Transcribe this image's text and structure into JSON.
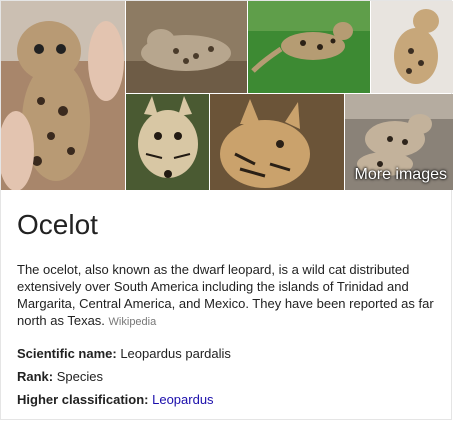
{
  "images": {
    "more_label": "More images",
    "items": [
      {
        "name": "kitten-held",
        "bg": "#a8866b",
        "spot": "#3a2a1e",
        "accent": "#c9b9a8"
      },
      {
        "name": "lying-on-log",
        "bg": "#8d7b63",
        "spot": "#4a3b2a",
        "accent": "#b7a68e"
      },
      {
        "name": "walking-grass",
        "bg": "#3d8a33",
        "spot": "#2b2116",
        "accent": "#b59c73"
      },
      {
        "name": "sitting-white",
        "bg": "#e8e4df",
        "spot": "#3b2e22",
        "accent": "#c7a77a"
      },
      {
        "name": "face-forest",
        "bg": "#4a5a32",
        "spot": "#221a12",
        "accent": "#d8c7a4"
      },
      {
        "name": "profile-head",
        "bg": "#6b5438",
        "spot": "#2a2016",
        "accent": "#caa26c"
      },
      {
        "name": "pair-building",
        "bg": "#8a8278",
        "spot": "#2d241b",
        "accent": "#c3b29b"
      }
    ]
  },
  "title": "Ocelot",
  "description": {
    "text": "The ocelot, also known as the dwarf leopard, is a wild cat distributed extensively over South America including the islands of Trinidad and Margarita, Central America, and Mexico. They have been reported as far north as Texas.",
    "source": "Wikipedia"
  },
  "facts": {
    "scientific_name": {
      "label": "Scientific name:",
      "value": "Leopardus pardalis"
    },
    "rank": {
      "label": "Rank:",
      "value": "Species"
    },
    "higher_classification": {
      "label": "Higher classification:",
      "value": "Leopardus"
    }
  }
}
